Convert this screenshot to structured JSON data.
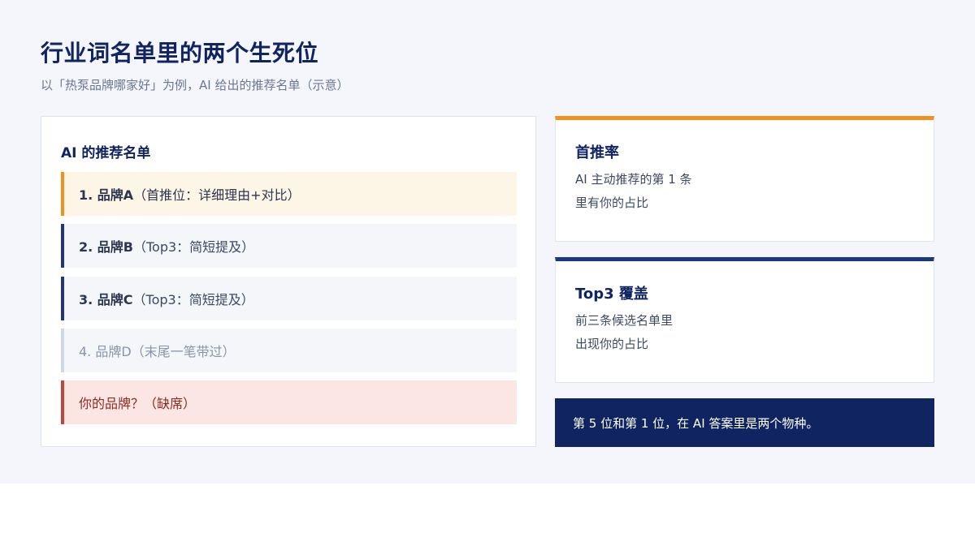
{
  "header": {
    "title": "行业词名单里的两个生死位",
    "subtitle": "以「热泵品牌哪家好」为例，AI 给出的推荐名单（示意）"
  },
  "list_card": {
    "title": "AI 的推荐名单",
    "items": [
      {
        "strong": "1. 品牌A",
        "detail": "（首推位：详细理由+对比）"
      },
      {
        "strong": "2. 品牌B",
        "detail": "（Top3：简短提及）"
      },
      {
        "strong": "3. 品牌C",
        "detail": "（Top3：简短提及）"
      },
      {
        "strong": "",
        "detail": "4. 品牌D（末尾一笔带过）"
      },
      {
        "strong": "",
        "detail": "你的品牌？（缺席）"
      }
    ]
  },
  "cards": [
    {
      "title": "首推率",
      "line1": "AI 主动推荐的第 1 条",
      "line2": "里有你的占比"
    },
    {
      "title": "Top3 覆盖",
      "line1": "前三条候选名单里",
      "line2": "出现你的占比"
    }
  ],
  "banner": {
    "text": "第 5 位和第 1 位，在 AI 答案里是两个物种。"
  },
  "colors": {
    "accent_orange": "#f0921a",
    "accent_navy": "#1a3780",
    "title_navy": "#0f2460",
    "missing_red": "#c2453a"
  }
}
